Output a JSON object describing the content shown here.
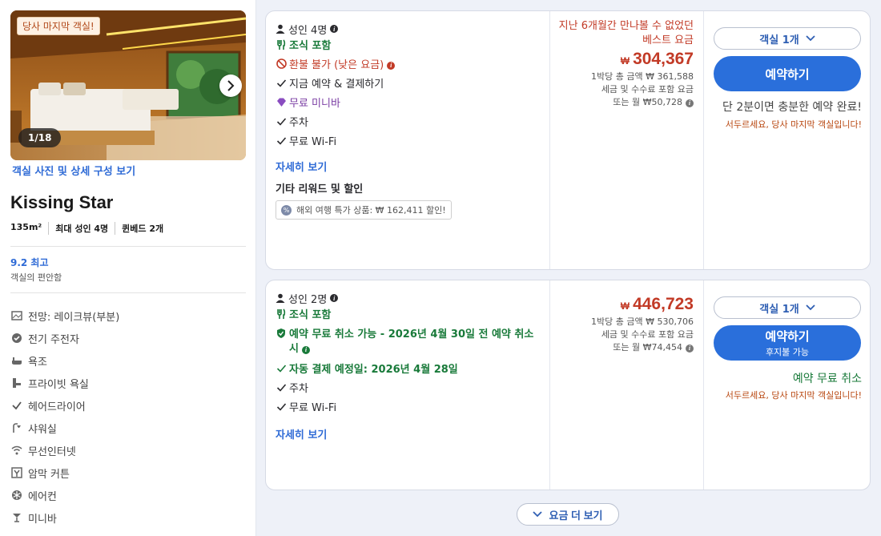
{
  "room": {
    "badge": "당사 마지막 객실!",
    "photo_counter": "1/18",
    "photo_link": "객실 사진 및 상세 구성 보기",
    "name": "Kissing Star",
    "specs": [
      "135m²",
      "최대 성인 4명",
      "퀸베드 2개"
    ],
    "score": "9.2 최고",
    "score_label": "객실의 편안함",
    "amenities": [
      {
        "icon": "view-icon",
        "label": "전망: 레이크뷰(부분)"
      },
      {
        "icon": "kettle-icon",
        "label": "전기 주전자"
      },
      {
        "icon": "bathtub-icon",
        "label": "욕조"
      },
      {
        "icon": "private-bath-icon",
        "label": "프라이빗 욕실"
      },
      {
        "icon": "check-icon",
        "label": "헤어드라이어"
      },
      {
        "icon": "shower-icon",
        "label": "샤워실"
      },
      {
        "icon": "wifi-icon",
        "label": "무선인터넷"
      },
      {
        "icon": "blackout-icon",
        "label": "암막 커튼"
      },
      {
        "icon": "snowflake-icon",
        "label": "에어컨"
      },
      {
        "icon": "cocktail-icon",
        "label": "미니바"
      }
    ]
  },
  "offers": [
    {
      "occupancy": "성인 4명",
      "features": [
        {
          "icon": "fork-icon",
          "text": "조식 포함",
          "style": "green"
        },
        {
          "icon": "no-refund-icon",
          "text": "환불 불가 (낮은 요금)",
          "style": "red",
          "info": true
        },
        {
          "icon": "check-icon",
          "text": "지금 예약 & 결제하기",
          "style": "plain"
        },
        {
          "icon": "diamond-icon",
          "text": "무료 미니바",
          "style": "purple"
        },
        {
          "icon": "check-icon",
          "text": "주차",
          "style": "plain"
        },
        {
          "icon": "check-icon",
          "text": "무료 Wi-Fi",
          "style": "plain"
        }
      ],
      "details_link": "자세히 보기",
      "rewards_title": "기타 리워드 및 할인",
      "promo": "해외 여행 특가 상품: ₩ 162,411 할인!",
      "best_price_note": "지난 6개월간 만나볼 수 없었던 베스트 요금",
      "currency": "₩",
      "price": "304,367",
      "per_night_total": "1박당 총 금액 ₩ 361,588",
      "tax_note": "세금 및 수수료 포함 요금",
      "monthly": "또는 월 ₩50,728",
      "room_qty": "객실 1개",
      "book_label": "예약하기",
      "urgency": "단 2분이면 충분한 예약 완료!",
      "warning": "서두르세요, 당사 마지막 객실입니다!"
    },
    {
      "occupancy": "성인 2명",
      "features": [
        {
          "icon": "fork-icon",
          "text": "조식 포함",
          "style": "green"
        },
        {
          "icon": "shield-check-icon",
          "text": "예약 무료 취소 가능 - 2026년 4월 30일 전 예약 취소 시",
          "style": "green-bold",
          "info": true
        },
        {
          "icon": "check-icon",
          "text": "자동 결제 예정일: 2026년 4월 28일",
          "style": "green-bold"
        },
        {
          "icon": "check-icon",
          "text": "주차",
          "style": "plain"
        },
        {
          "icon": "check-icon",
          "text": "무료 Wi-Fi",
          "style": "plain"
        }
      ],
      "details_link": "자세히 보기",
      "currency": "₩",
      "price": "446,723",
      "per_night_total": "1박당 총 금액 ₩ 530,706",
      "tax_note": "세금 및 수수료 포함 요금",
      "monthly": "또는 월 ₩74,454",
      "room_qty": "객실 1개",
      "book_label": "예약하기",
      "book_sublabel": "후지불 가능",
      "free_cancel": "예약 무료 취소",
      "warning": "서두르세요, 당사 마지막 객실입니다!"
    }
  ],
  "more_rates": "요금 더 보기",
  "colors": {
    "accent": "#2a6fdb",
    "price": "#c23a26",
    "green": "#197a3a",
    "link": "#2f6bd6"
  }
}
